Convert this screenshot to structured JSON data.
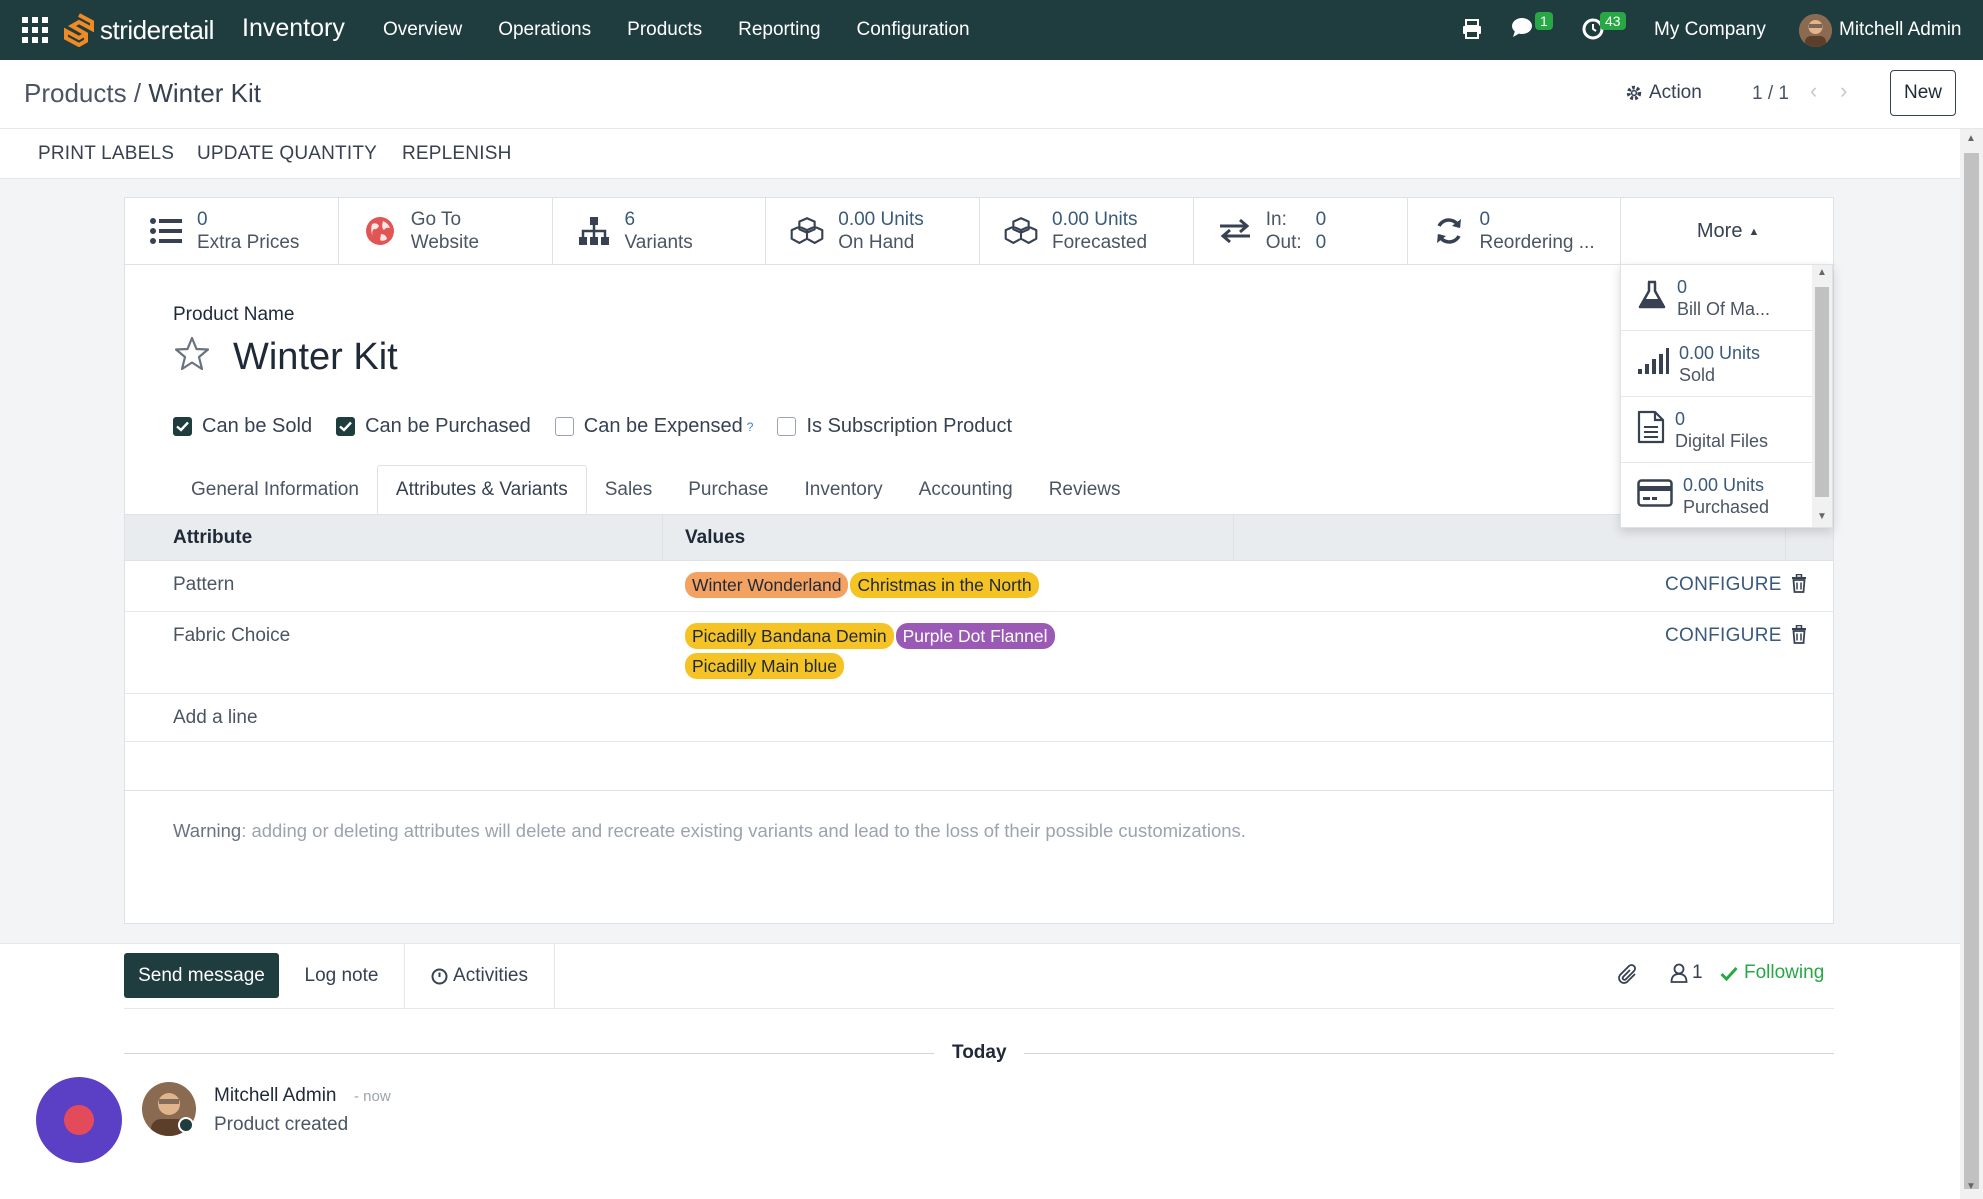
{
  "navbar": {
    "logo_text": "strideretail",
    "app_title": "Inventory",
    "menu": [
      "Overview",
      "Operations",
      "Products",
      "Reporting",
      "Configuration"
    ],
    "messages_count": "1",
    "activities_count": "43",
    "company": "My Company",
    "user": "Mitchell Admin"
  },
  "control": {
    "breadcrumb_parent": "Products",
    "breadcrumb_sep": "/",
    "breadcrumb_current": "Winter Kit",
    "action_label": "Action",
    "pager": "1 / 1",
    "new_label": "New"
  },
  "statusbar": {
    "print_labels": "PRINT LABELS",
    "update_quantity": "UPDATE QUANTITY",
    "replenish": "REPLENISH"
  },
  "stats": [
    {
      "num": "0",
      "label": "Extra Prices",
      "icon": "list-icon"
    },
    {
      "num": "Go To",
      "label": "Website",
      "icon": "globe-icon"
    },
    {
      "num": "6",
      "label": "Variants",
      "icon": "sitemap-icon"
    },
    {
      "num": "0.00 Units",
      "label": "On Hand",
      "icon": "cubes-icon"
    },
    {
      "num": "0.00 Units",
      "label": "Forecasted",
      "icon": "cubes-icon"
    },
    {
      "num_in": "0",
      "num_out": "0",
      "label_in": "In:",
      "label_out": "Out:",
      "icon": "exchange-icon"
    },
    {
      "num": "0",
      "label": "Reordering ...",
      "icon": "refresh-icon"
    }
  ],
  "more_label": "More",
  "more_items": [
    {
      "num": "0",
      "label": "Bill Of Ma...",
      "icon": "flask-icon"
    },
    {
      "num": "0.00 Units",
      "label": "Sold",
      "icon": "signal-icon"
    },
    {
      "num": "0",
      "label": "Digital Files",
      "icon": "file-icon"
    },
    {
      "num": "0.00 Units",
      "label": "Purchased",
      "icon": "credit-card-icon"
    }
  ],
  "form": {
    "product_name_label": "Product Name",
    "product_name": "Winter Kit",
    "checkboxes": [
      {
        "label": "Can be Sold",
        "checked": true
      },
      {
        "label": "Can be Purchased",
        "checked": true
      },
      {
        "label": "Can be Expensed",
        "checked": false,
        "help": "?"
      },
      {
        "label": "Is Subscription Product",
        "checked": false
      }
    ],
    "tabs": [
      "General Information",
      "Attributes & Variants",
      "Sales",
      "Purchase",
      "Inventory",
      "Accounting",
      "Reviews"
    ],
    "active_tab": "Attributes & Variants"
  },
  "table": {
    "col_attribute": "Attribute",
    "col_values": "Values",
    "rows": [
      {
        "attribute": "Pattern",
        "values": [
          {
            "text": "Winter Wonderland",
            "color": "#f4a261"
          },
          {
            "text": "Christmas in the North",
            "color": "#f6c324"
          }
        ],
        "configure": "CONFIGURE"
      },
      {
        "attribute": "Fabric Choice",
        "values": [
          {
            "text": "Picadilly Bandana Demin",
            "color": "#f6c324"
          },
          {
            "text": "Purple Dot Flannel",
            "color": "#9b59b6"
          },
          {
            "text": "Picadilly Main blue",
            "color": "#f6c324"
          }
        ],
        "configure": "CONFIGURE"
      }
    ],
    "add_line": "Add a line"
  },
  "warning": {
    "label": "Warning",
    "text": ": adding or deleting attributes will delete and recreate existing variants and lead to the loss of their possible customizations."
  },
  "chatter": {
    "send_message": "Send message",
    "log_note": "Log note",
    "activities": "Activities",
    "followers_count": "1",
    "following": "Following",
    "date_separator": "Today",
    "message_author": "Mitchell Admin",
    "message_time": "- now",
    "message_body": "Product created"
  }
}
